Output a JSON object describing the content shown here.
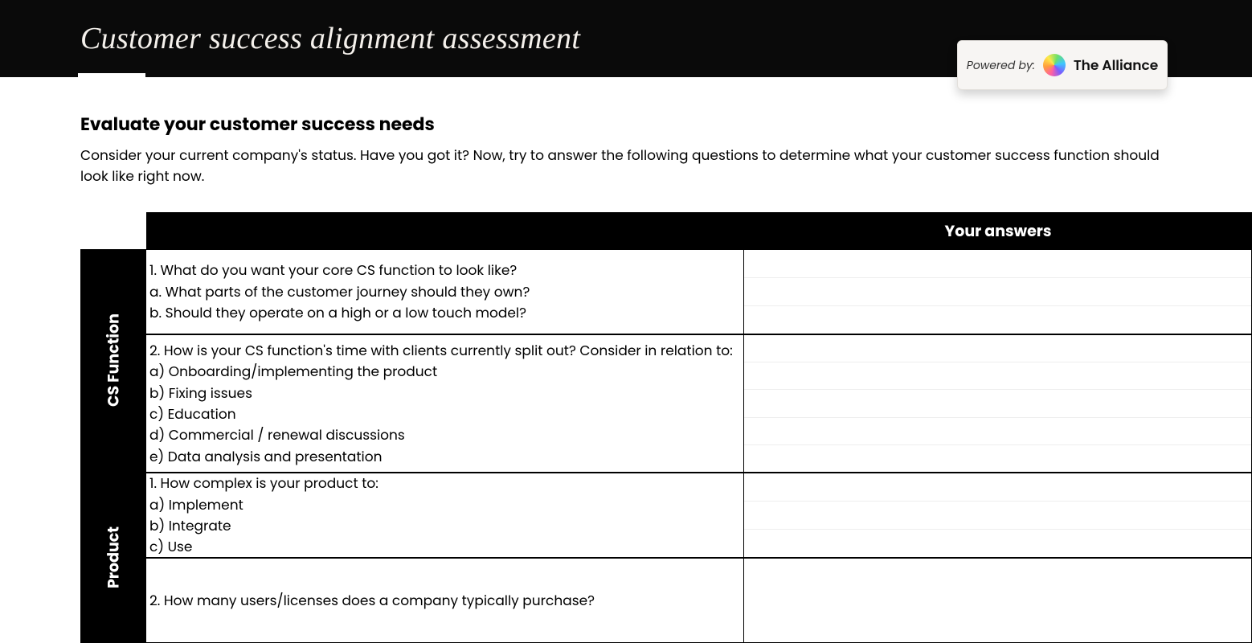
{
  "banner": {
    "title": "Customer success alignment assessment"
  },
  "powered": {
    "label": "Powered by:",
    "brand": "The Alliance"
  },
  "intro": {
    "heading": "Evaluate your customer success needs",
    "body": "Consider your current company's status. Have you got it? Now, try to answer the following questions to determine what your customer success function should look like right now."
  },
  "table": {
    "answers_header": "Your answers",
    "sections": [
      {
        "label": "CS Function",
        "questions": [
          "1. What do you want your core CS function to look like?\n       a. What parts of the customer journey should they own?\n        b. Should they operate on a high or a low touch model?",
          "2. How is your CS function's time with clients currently split out?  Consider in relation to:\n     a) Onboarding/implementing the product\n     b) Fixing issues\n     c) Education\n     d) Commercial / renewal discussions\n     e) Data analysis and presentation"
        ],
        "answer_rows": [
          3,
          5
        ]
      },
      {
        "label": "Product",
        "questions": [
          "1. How complex is your product to:\n    a) Implement\n    b) Integrate\n    c) Use",
          "2. How many users/licenses does a company typically purchase?"
        ],
        "answer_rows": [
          3,
          1
        ]
      }
    ]
  }
}
